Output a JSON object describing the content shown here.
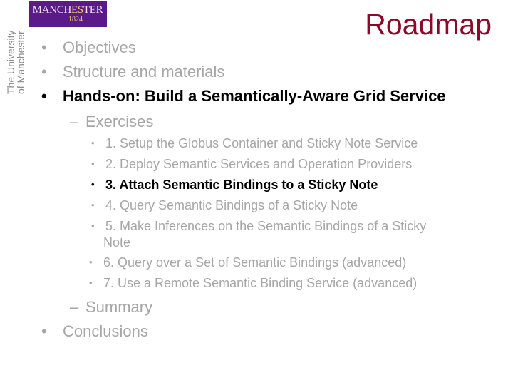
{
  "logo": {
    "name_part1": "MANCH",
    "name_highlight": "ES",
    "name_part2": "T",
    "name_part3": "ER",
    "year": "1824",
    "background_color": "#5b1a8a"
  },
  "university": {
    "line1": "The University",
    "line2": "of Manchester"
  },
  "slide": {
    "title": "Roadmap",
    "title_color": "#8b0a2a",
    "outline": [
      {
        "label": "Objectives",
        "active": false
      },
      {
        "label": "Structure and materials",
        "active": false
      },
      {
        "label": "Hands-on: Build a Semantically-Aware Grid Service",
        "active": true,
        "sub": [
          {
            "label": "Exercises",
            "active": false,
            "items": [
              {
                "label": "1. Setup the Globus Container and Sticky Note Service",
                "active": false
              },
              {
                "label": "2. Deploy Semantic Services and Operation Providers",
                "active": false
              },
              {
                "label": "3. Attach Semantic Bindings to a Sticky Note",
                "active": true
              },
              {
                "label": "4. Query Semantic Bindings of a Sticky Note",
                "active": false
              },
              {
                "label": "5. Make Inferences on the Semantic Bindings of a Sticky",
                "continuation": "Note",
                "active": false
              },
              {
                "label": "6. Query over a Set of Semantic Bindings (advanced)",
                "active": false
              },
              {
                "label": "7. Use a Remote Semantic Binding Service (advanced)",
                "active": false
              }
            ]
          },
          {
            "label": "Summary",
            "active": false
          }
        ]
      },
      {
        "label": "Conclusions",
        "active": false
      }
    ],
    "bullet_glyph": "•",
    "dash_glyph": "–"
  }
}
